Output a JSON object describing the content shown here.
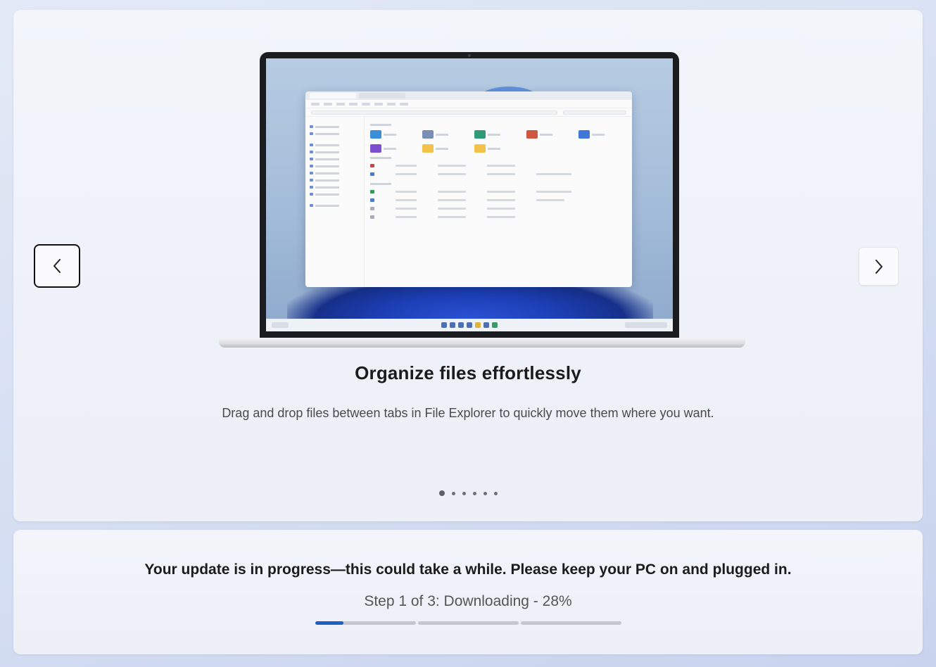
{
  "slide": {
    "title": "Organize files effortlessly",
    "description": "Drag and drop files between tabs in File Explorer to quickly move them where you want.",
    "current_index": 1,
    "total": 6
  },
  "navigation": {
    "prev_icon": "chevron-left-icon",
    "next_icon": "chevron-right-icon"
  },
  "update": {
    "message": "Your update is in progress—this could take a while. Please keep your PC on and plugged in.",
    "status": "Step 1 of 3: Downloading - 28%",
    "steps_total": 3,
    "current_step": 1,
    "step_progress": 0.28
  },
  "colors": {
    "accent": "#1d5fc4",
    "track": "#c3c7cf"
  }
}
